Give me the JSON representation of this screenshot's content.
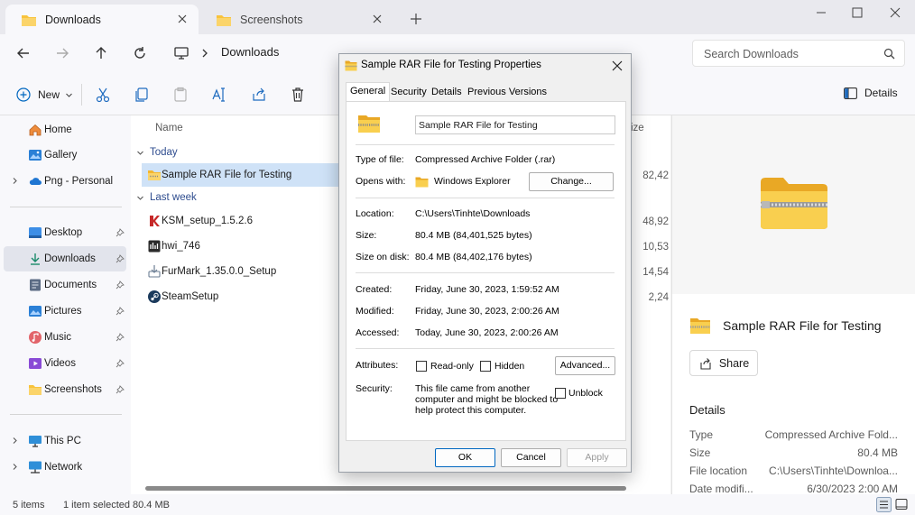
{
  "tabs": [
    {
      "label": "Downloads",
      "icon": "folder-icon"
    },
    {
      "label": "Screenshots",
      "icon": "folder-icon"
    }
  ],
  "address": {
    "breadcrumb": "Downloads",
    "search_placeholder": "Search Downloads"
  },
  "command_bar": {
    "new_label": "New",
    "details_label": "Details"
  },
  "nav": {
    "home": "Home",
    "gallery": "Gallery",
    "personal": "Png - Personal",
    "desktop": "Desktop",
    "downloads": "Downloads",
    "documents": "Documents",
    "pictures": "Pictures",
    "music": "Music",
    "videos": "Videos",
    "screenshots": "Screenshots",
    "this_pc": "This PC",
    "network": "Network"
  },
  "file_list": {
    "col_name": "Name",
    "col_size": "ize",
    "group_today": "Today",
    "group_lastweek": "Last week",
    "files": [
      {
        "name": "Sample RAR File for Testing",
        "size": "82,42"
      },
      {
        "name": "KSM_setup_1.5.2.6",
        "size": "48,92"
      },
      {
        "name": "hwi_746",
        "size": "10,53"
      },
      {
        "name": "FurMark_1.35.0.0_Setup",
        "size": "14,54"
      },
      {
        "name": "SteamSetup",
        "size": "2,24"
      }
    ]
  },
  "details_pane": {
    "title": "Sample RAR File for Testing",
    "share_label": "Share",
    "section": "Details",
    "rows": [
      {
        "k": "Type",
        "v": "Compressed Archive Fold..."
      },
      {
        "k": "Size",
        "v": "80.4 MB"
      },
      {
        "k": "File location",
        "v": "C:\\Users\\Tinhte\\Downloa..."
      },
      {
        "k": "Date modifi...",
        "v": "6/30/2023 2:00 AM"
      }
    ]
  },
  "status": {
    "items": "5 items",
    "selected": "1 item selected",
    "size": "80.4 MB"
  },
  "dialog": {
    "title": "Sample RAR File for Testing Properties",
    "tabs": [
      "General",
      "Security",
      "Details",
      "Previous Versions"
    ],
    "filename": "Sample RAR File for Testing",
    "type_label": "Type of file:",
    "type_value": "Compressed Archive Folder (.rar)",
    "opens_label": "Opens with:",
    "opens_value": "Windows Explorer",
    "change_label": "Change...",
    "location_label": "Location:",
    "location_value": "C:\\Users\\Tinhte\\Downloads",
    "size_label": "Size:",
    "size_value": "80.4 MB (84,401,525 bytes)",
    "disk_label": "Size on disk:",
    "disk_value": "80.4 MB (84,402,176 bytes)",
    "created_label": "Created:",
    "created_value": "Friday, June 30, 2023, 1:59:52 AM",
    "modified_label": "Modified:",
    "modified_value": "Friday, June 30, 2023, 2:00:26 AM",
    "accessed_label": "Accessed:",
    "accessed_value": "Today, June 30, 2023, 2:00:26 AM",
    "attributes_label": "Attributes:",
    "readonly_label": "Read-only",
    "hidden_label": "Hidden",
    "advanced_label": "Advanced...",
    "security_label": "Security:",
    "security_text": [
      "This file came from another",
      "computer and might be blocked to",
      "help protect this computer."
    ],
    "unblock_label": "Unblock",
    "ok_label": "OK",
    "cancel_label": "Cancel",
    "apply_label": "Apply"
  },
  "colors": {
    "accent": "#0067c0",
    "folder": "#f8c33c",
    "selection": "#cfe2f7"
  }
}
